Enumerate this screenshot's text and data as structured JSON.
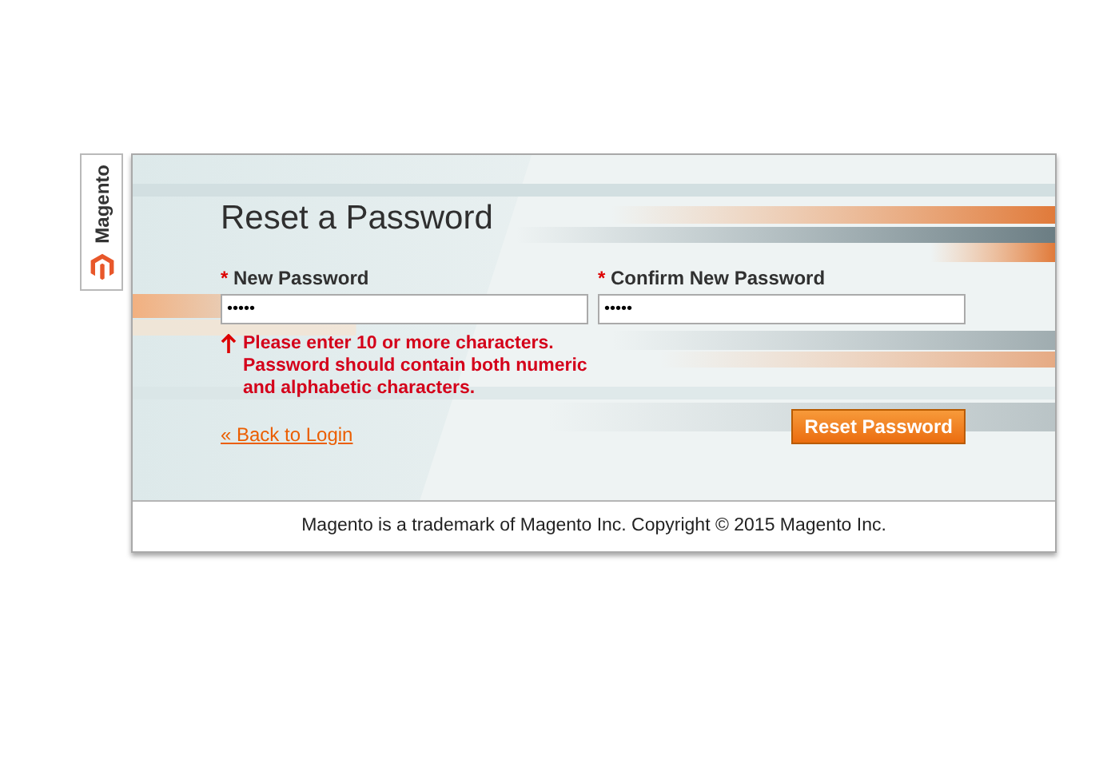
{
  "side_tab": {
    "label": "Magento"
  },
  "form": {
    "title": "Reset a Password",
    "fields": [
      {
        "label": "New Password",
        "required_mark": "*",
        "value": "•••••",
        "error": "Please enter 10 or more characters. Password should contain both numeric and alphabetic characters."
      },
      {
        "label": "Confirm New Password",
        "required_mark": "*",
        "value": "•••••"
      }
    ],
    "back_link": "« Back to Login",
    "submit_button": "Reset Password"
  },
  "footer": "Magento is a trademark of Magento Inc. Copyright © 2015 Magento Inc."
}
